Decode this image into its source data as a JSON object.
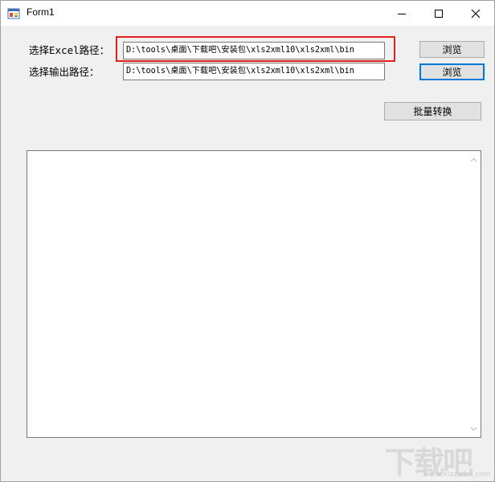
{
  "window": {
    "title": "Form1"
  },
  "form": {
    "excel_label": "选择Excel路径：",
    "excel_path": "D:\\tools\\桌面\\下载吧\\安装包\\xls2xml10\\xls2xml\\bin",
    "output_label": "选择输出路径：",
    "output_path": "D:\\tools\\桌面\\下载吧\\安装包\\xls2xml10\\xls2xml\\bin",
    "browse_excel_label": "浏览",
    "browse_output_label": "浏览",
    "batch_convert_label": "批量转换"
  },
  "log": {
    "content": ""
  },
  "watermark": {
    "brand": "下载吧",
    "url": "www.xiazaiba.com"
  },
  "colors": {
    "highlight": "#e01f1f",
    "focus": "#0078d7"
  }
}
